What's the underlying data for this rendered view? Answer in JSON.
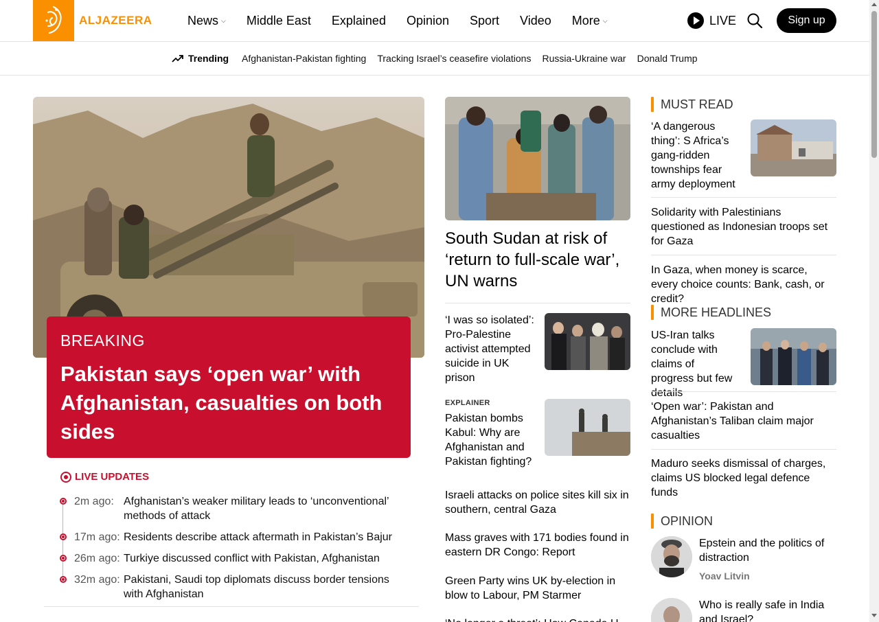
{
  "header": {
    "logo_text": "ALJAZEERA",
    "nav": [
      {
        "label": "News",
        "dropdown": true
      },
      {
        "label": "Middle East",
        "dropdown": false
      },
      {
        "label": "Explained",
        "dropdown": false
      },
      {
        "label": "Opinion",
        "dropdown": false
      },
      {
        "label": "Sport",
        "dropdown": false
      },
      {
        "label": "Video",
        "dropdown": false
      },
      {
        "label": "More",
        "dropdown": true
      }
    ],
    "live_label": "LIVE",
    "signup_label": "Sign up"
  },
  "trending": {
    "label": "Trending",
    "links": [
      "Afghanistan-Pakistan fighting",
      "Tracking Israel’s ceasefire violations",
      "Russia-Ukraine war",
      "Donald Trump"
    ]
  },
  "hero": {
    "label": "BREAKING",
    "title": "Pakistan says ‘open war’ with Afghanistan, casualties on both sides"
  },
  "live_updates": {
    "label": "LIVE UPDATES",
    "items": [
      {
        "time": "2m ago:",
        "text": "Afghanistan’s weaker military leads to ‘unconventional’ methods of attack"
      },
      {
        "time": "17m ago:",
        "text": "Residents describe attack aftermath in Pakistan’s Bajur"
      },
      {
        "time": "26m ago:",
        "text": "Turkiye discussed conflict with Pakistan, Afghanistan"
      },
      {
        "time": "32m ago:",
        "text": "Pakistani, Saudi top diplomats discuss border tensions with Afghanistan"
      }
    ]
  },
  "middle": {
    "lead_title": "South Sudan at risk of ‘return to full-scale war’, UN warns",
    "item1": "‘I was so isolated’: Pro-Palestine activist attempted suicide in UK prison",
    "item2_kicker": "EXPLAINER",
    "item2": "Pakistan bombs Kabul: Why are Afghanistan and Pakistan fighting?",
    "text_items": [
      "Israeli attacks on police sites kill six in southern, central Gaza",
      "Mass graves with 171 bodies found in eastern DR Congo: Report",
      "Green Party wins UK by-election in blow to Labour, PM Starmer",
      "‘No longer a threat’: How Canada U..."
    ]
  },
  "must_read": {
    "label": "MUST READ",
    "items": [
      "‘A dangerous thing’: S Africa’s gang-ridden townships fear army deployment",
      "Solidarity with Palestinians questioned as Indonesian troops set for Gaza",
      "In Gaza, when money is scarce, every choice counts: Bank, cash, or credit?"
    ]
  },
  "more_headlines": {
    "label": "MORE HEADLINES",
    "items": [
      "US-Iran talks conclude with claims of progress but few details",
      "‘Open war’: Pakistan and Afghanistan’s Taliban claim major casualties",
      "Maduro seeks dismissal of charges, claims US blocked legal defence funds"
    ]
  },
  "opinion": {
    "label": "OPINION",
    "items": [
      {
        "title": "Epstein and the politics of distraction",
        "author": "Yoav Litvin"
      },
      {
        "title": "Who is really safe in India and Israel?",
        "author": ""
      }
    ]
  },
  "colors": {
    "brand_orange": "#fa9000",
    "breaking_red": "#c8102e"
  }
}
